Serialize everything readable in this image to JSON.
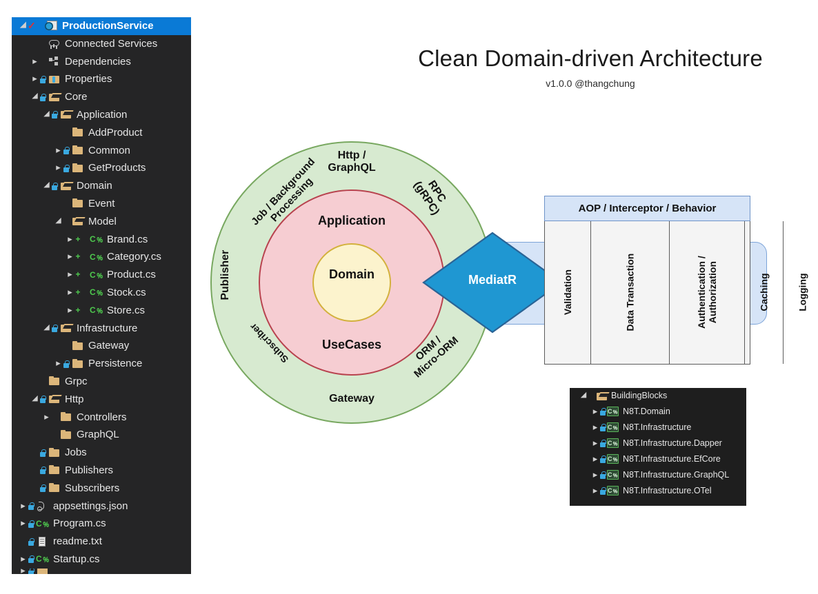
{
  "title": {
    "heading": "Clean Domain-driven Architecture",
    "subtitle": "v1.0.0 @thangchung"
  },
  "solution_explorer": {
    "name": "solution-explorer",
    "items": [
      {
        "label": "ProductionService",
        "depth": 0,
        "chev": "open",
        "icon": "project-globe-icon",
        "lock": false,
        "check": true,
        "selected": true
      },
      {
        "label": "Connected Services",
        "depth": 1,
        "chev": "none",
        "icon": "cloud-icon",
        "lock": false
      },
      {
        "label": "Dependencies",
        "depth": 1,
        "chev": "closed",
        "icon": "dependencies-icon",
        "lock": false
      },
      {
        "label": "Properties",
        "depth": 1,
        "chev": "closed",
        "icon": "properties-folder-icon",
        "lock": true
      },
      {
        "label": "Core",
        "depth": 1,
        "chev": "open",
        "icon": "folder-open-icon",
        "lock": true
      },
      {
        "label": "Application",
        "depth": 2,
        "chev": "open",
        "icon": "folder-open-icon",
        "lock": true
      },
      {
        "label": "AddProduct",
        "depth": 3,
        "chev": "none",
        "icon": "folder-icon",
        "lock": false
      },
      {
        "label": "Common",
        "depth": 3,
        "chev": "closed",
        "icon": "folder-icon",
        "lock": true
      },
      {
        "label": "GetProducts",
        "depth": 3,
        "chev": "closed",
        "icon": "folder-icon",
        "lock": true
      },
      {
        "label": "Domain",
        "depth": 2,
        "chev": "open",
        "icon": "folder-open-icon",
        "lock": true
      },
      {
        "label": "Event",
        "depth": 3,
        "chev": "none",
        "icon": "folder-icon",
        "lock": false
      },
      {
        "label": "Model",
        "depth": 3,
        "chev": "open",
        "icon": "folder-open-icon",
        "lock": false
      },
      {
        "label": "Brand.cs",
        "depth": 4,
        "chev": "closed",
        "icon": "csharp-file-icon",
        "lock": false,
        "plus": true
      },
      {
        "label": "Category.cs",
        "depth": 4,
        "chev": "closed",
        "icon": "csharp-file-icon",
        "lock": false,
        "plus": true
      },
      {
        "label": "Product.cs",
        "depth": 4,
        "chev": "closed",
        "icon": "csharp-file-icon",
        "lock": false,
        "plus": true
      },
      {
        "label": "Stock.cs",
        "depth": 4,
        "chev": "closed",
        "icon": "csharp-file-icon",
        "lock": false,
        "plus": true
      },
      {
        "label": "Store.cs",
        "depth": 4,
        "chev": "closed",
        "icon": "csharp-file-icon",
        "lock": false,
        "plus": true
      },
      {
        "label": "Infrastructure",
        "depth": 2,
        "chev": "open",
        "icon": "folder-open-icon",
        "lock": true
      },
      {
        "label": "Gateway",
        "depth": 3,
        "chev": "none",
        "icon": "folder-icon",
        "lock": false
      },
      {
        "label": "Persistence",
        "depth": 3,
        "chev": "closed",
        "icon": "folder-icon",
        "lock": true
      },
      {
        "label": "Grpc",
        "depth": 1,
        "chev": "none",
        "icon": "folder-icon",
        "lock": false
      },
      {
        "label": "Http",
        "depth": 1,
        "chev": "open",
        "icon": "folder-open-icon",
        "lock": true
      },
      {
        "label": "Controllers",
        "depth": 2,
        "chev": "closed",
        "icon": "folder-icon",
        "lock": false
      },
      {
        "label": "GraphQL",
        "depth": 2,
        "chev": "none",
        "icon": "folder-icon",
        "lock": false
      },
      {
        "label": "Jobs",
        "depth": 1,
        "chev": "none",
        "icon": "folder-icon",
        "lock": true
      },
      {
        "label": "Publishers",
        "depth": 1,
        "chev": "none",
        "icon": "folder-icon",
        "lock": true
      },
      {
        "label": "Subscribers",
        "depth": 1,
        "chev": "none",
        "icon": "folder-icon",
        "lock": true
      },
      {
        "label": "appsettings.json",
        "depth": 0,
        "chev": "closed",
        "icon": "json-file-icon",
        "lock": true
      },
      {
        "label": "Program.cs",
        "depth": 0,
        "chev": "closed",
        "icon": "csharp-file-icon",
        "lock": true
      },
      {
        "label": "readme.txt",
        "depth": 0,
        "chev": "none",
        "icon": "text-file-icon",
        "lock": true
      },
      {
        "label": "Startup.cs",
        "depth": 0,
        "chev": "closed",
        "icon": "csharp-file-icon",
        "lock": true
      }
    ]
  },
  "circles": {
    "inner": "Domain",
    "middle_top": "Application",
    "middle_bottom": "UseCases",
    "outer_top": "Http /\nGraphQL",
    "outer_bottom": "Gateway",
    "outer_left": "Publisher",
    "outer_topleft": "Job / Background\nProcessing",
    "outer_topright": "RPC\n(gRPC)",
    "outer_bottomleft": "Subscriber",
    "outer_bottomright": "ORM /\nMicro-ORM",
    "colors": {
      "outer_fill": "#d7ead0",
      "outer_stroke": "#78a860",
      "middle_fill": "#f6cdd2",
      "middle_stroke": "#b8434f",
      "inner_fill": "#fcf3cd",
      "inner_stroke": "#d3b13d"
    }
  },
  "mediatr": {
    "label": "MediatR",
    "fill": "#1f97d2",
    "stroke": "#2a6496"
  },
  "aop": {
    "header": "AOP / Interceptor / Behavior",
    "header_fill": "#d6e4f7",
    "columns": [
      "Validation",
      "Data Transaction",
      "Authentication /\nAuthorization",
      "Caching",
      "Logging",
      "..."
    ]
  },
  "building_blocks": {
    "items": [
      {
        "label": "BuildingBlocks",
        "depth": 0,
        "chev": "open",
        "icon": "folder-open-icon",
        "lock": false
      },
      {
        "label": "N8T.Domain",
        "depth": 1,
        "chev": "closed",
        "icon": "csproj-icon",
        "lock": true
      },
      {
        "label": "N8T.Infrastructure",
        "depth": 1,
        "chev": "closed",
        "icon": "csproj-icon",
        "lock": true
      },
      {
        "label": "N8T.Infrastructure.Dapper",
        "depth": 1,
        "chev": "closed",
        "icon": "csproj-icon",
        "lock": true
      },
      {
        "label": "N8T.Infrastructure.EfCore",
        "depth": 1,
        "chev": "closed",
        "icon": "csproj-icon",
        "lock": true
      },
      {
        "label": "N8T.Infrastructure.GraphQL",
        "depth": 1,
        "chev": "closed",
        "icon": "csproj-icon",
        "lock": true
      },
      {
        "label": "N8T.Infrastructure.OTel",
        "depth": 1,
        "chev": "closed",
        "icon": "csproj-icon",
        "lock": true
      }
    ]
  }
}
